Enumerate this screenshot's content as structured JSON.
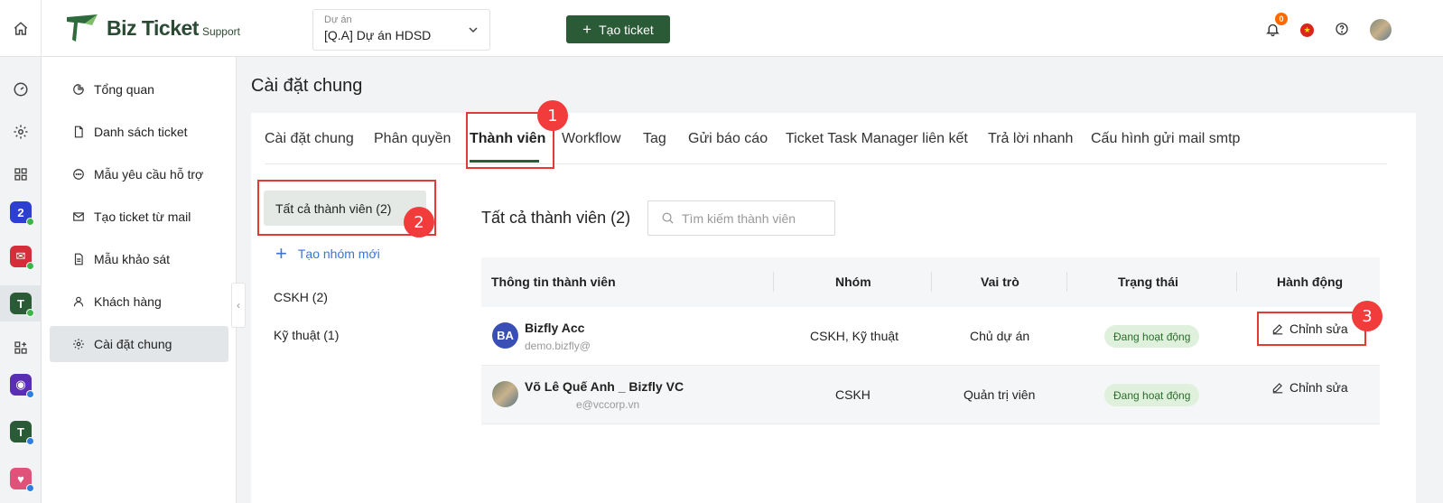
{
  "header": {
    "brand": "Biz Ticket",
    "brand_sub": "Support",
    "project_label": "Dự án",
    "project_value": "[Q.A] Dự án HDSD",
    "create_button": "Tạo ticket",
    "notification_count": "0"
  },
  "sidebar": {
    "items": [
      {
        "label": "Tổng quan",
        "icon": "pie-chart-icon"
      },
      {
        "label": "Danh sách ticket",
        "icon": "document-icon"
      },
      {
        "label": "Mẫu yêu cầu hỗ trợ",
        "icon": "chat-icon"
      },
      {
        "label": "Tạo ticket từ mail",
        "icon": "mail-icon"
      },
      {
        "label": "Mẫu khảo sát",
        "icon": "form-icon"
      },
      {
        "label": "Khách hàng",
        "icon": "user-icon"
      },
      {
        "label": "Cài đặt chung",
        "icon": "gear-icon"
      }
    ]
  },
  "page": {
    "title": "Cài đặt chung"
  },
  "tabs": [
    "Cài đặt chung",
    "Phân quyền",
    "Thành viên",
    "Workflow",
    "Tag",
    "Gửi báo cáo",
    "Ticket Task Manager liên kết",
    "Trả lời nhanh",
    "Cấu hình gửi mail smtp"
  ],
  "groups": {
    "all": "Tất cả thành viên (2)",
    "new_group": "Tạo nhóm mới",
    "list": [
      "CSKH (2)",
      "Kỹ thuật (1)"
    ]
  },
  "members": {
    "title": "Tất cả thành viên (2)",
    "search_placeholder": "Tìm kiếm thành viên",
    "columns": [
      "Thông tin thành viên",
      "Nhóm",
      "Vai trò",
      "Trạng thái",
      "Hành động"
    ],
    "rows": [
      {
        "initials": "BA",
        "name": "Bizfly Acc",
        "email": "demo.bizfly@",
        "group": "CSKH, Kỹ thuật",
        "role": "Chủ dự án",
        "status": "Đang hoạt động",
        "action": "Chỉnh sửa"
      },
      {
        "initials": "",
        "name": "Võ Lê Quế Anh _ Bizfly VC",
        "email": "e@vccorp.vn",
        "group": "CSKH",
        "role": "Quản trị viên",
        "status": "Đang hoạt động",
        "action": "Chỉnh sửa"
      }
    ]
  },
  "annotations": [
    "1",
    "2",
    "3"
  ],
  "colors": {
    "primary": "#2b5a36",
    "annotation": "#f23b3b",
    "status_bg": "#dff1dc",
    "link": "#3a73d9"
  }
}
